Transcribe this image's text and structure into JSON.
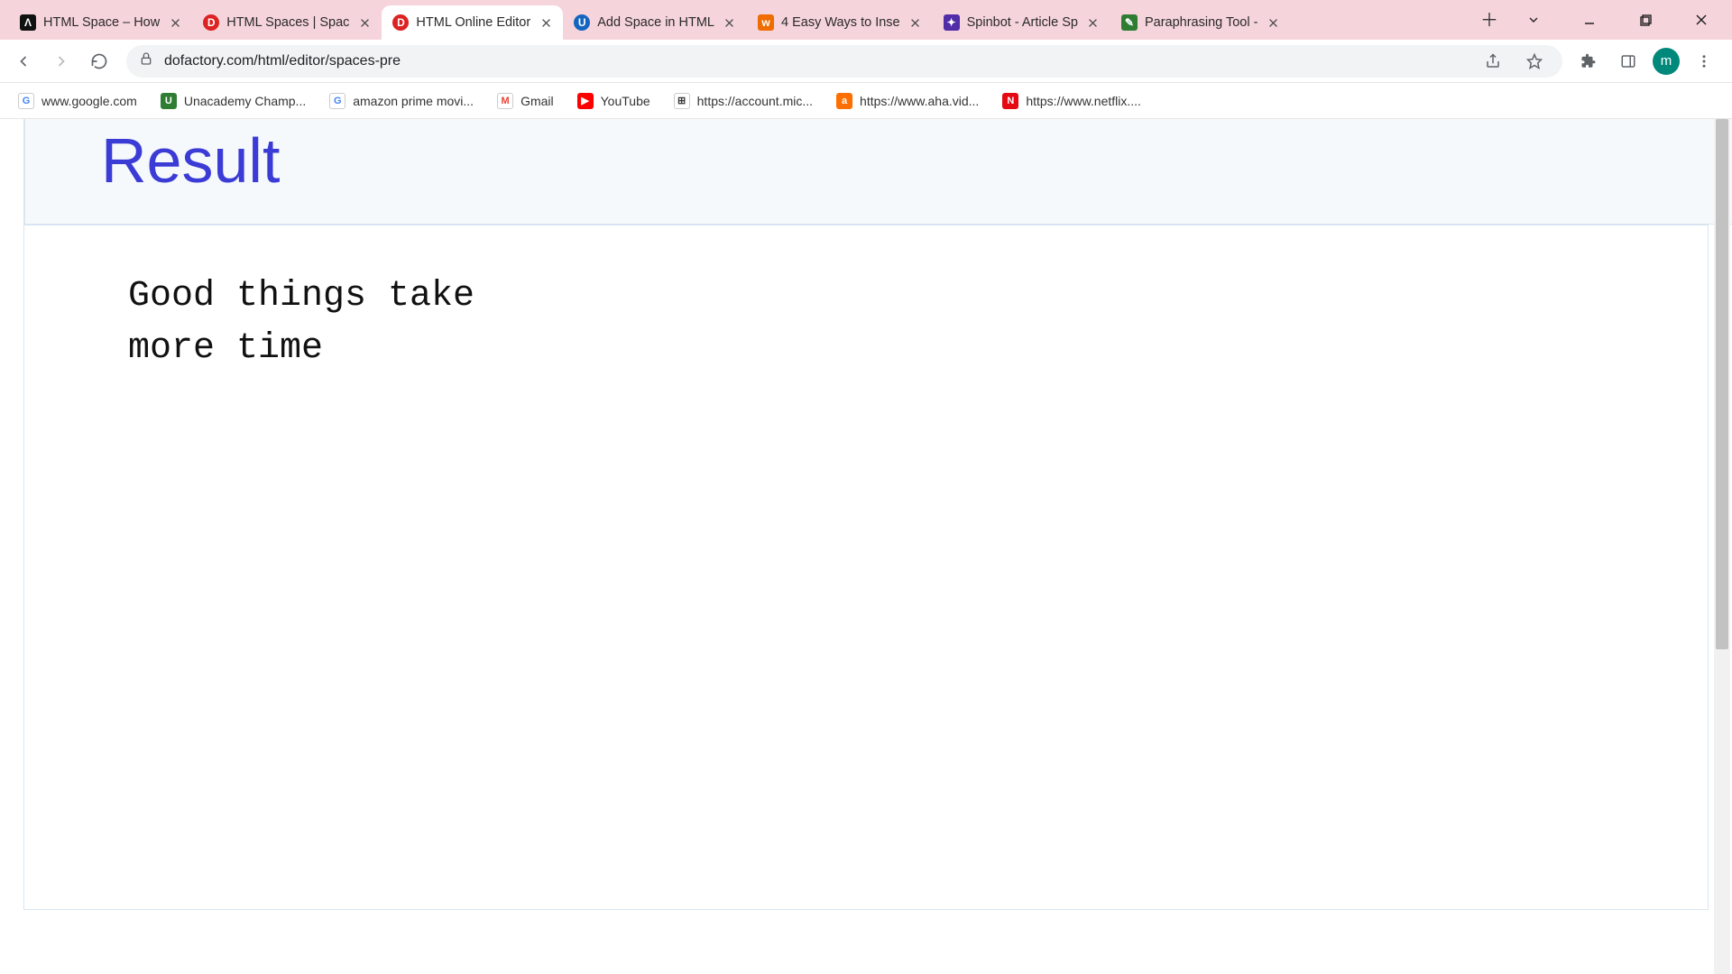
{
  "window": {
    "profile_initial": "m"
  },
  "tabs": [
    {
      "title": "HTML Space – How",
      "favicon_class": "fav-black",
      "favicon_glyph": "Λ",
      "active": false
    },
    {
      "title": "HTML Spaces | Spac",
      "favicon_class": "fav-red",
      "favicon_glyph": "D",
      "active": false
    },
    {
      "title": "HTML Online Editor",
      "favicon_class": "fav-red",
      "favicon_glyph": "D",
      "active": true
    },
    {
      "title": "Add Space in HTML",
      "favicon_class": "fav-blue",
      "favicon_glyph": "U",
      "active": false
    },
    {
      "title": "4 Easy Ways to Inse",
      "favicon_class": "fav-orange",
      "favicon_glyph": "w",
      "active": false
    },
    {
      "title": "Spinbot - Article Sp",
      "favicon_class": "fav-purple",
      "favicon_glyph": "✦",
      "active": false
    },
    {
      "title": "Paraphrasing Tool -",
      "favicon_class": "fav-green",
      "favicon_glyph": "✎",
      "active": false
    }
  ],
  "omnibox": {
    "url": "dofactory.com/html/editor/spaces-pre"
  },
  "bookmarks": [
    {
      "label": "www.google.com",
      "cls": "bmf-g",
      "glyph": "G"
    },
    {
      "label": "Unacademy Champ...",
      "cls": "bmf-u",
      "glyph": "U"
    },
    {
      "label": "amazon prime movi...",
      "cls": "bmf-gs",
      "glyph": "G"
    },
    {
      "label": "Gmail",
      "cls": "bmf-gm",
      "glyph": "M"
    },
    {
      "label": "YouTube",
      "cls": "bmf-yt",
      "glyph": "▶"
    },
    {
      "label": "https://account.mic...",
      "cls": "bmf-ms",
      "glyph": "⊞"
    },
    {
      "label": "https://www.aha.vid...",
      "cls": "bmf-aha",
      "glyph": "a"
    },
    {
      "label": "https://www.netflix....",
      "cls": "bmf-n",
      "glyph": "N"
    }
  ],
  "page": {
    "heading": "Result",
    "pre_text": "Good things take\nmore time"
  }
}
